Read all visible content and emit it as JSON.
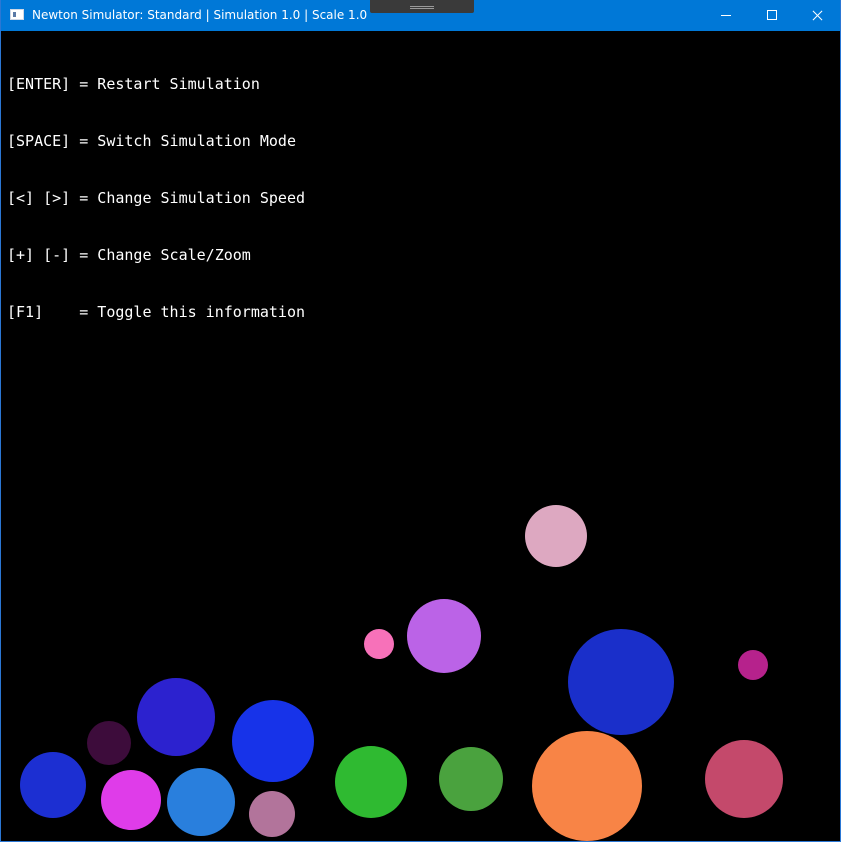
{
  "window": {
    "title": "Newton Simulator: Standard | Simulation 1.0 | Scale 1.0",
    "icon": "app-window-icon"
  },
  "controls": {
    "minimize": "minimize-icon",
    "maximize": "maximize-icon",
    "close": "close-icon"
  },
  "info": {
    "lines": [
      "[ENTER] = Restart Simulation",
      "[SPACE] = Switch Simulation Mode",
      "[<] [>] = Change Simulation Speed",
      "[+] [-] = Change Scale/Zoom",
      "[F1]    = Toggle this information"
    ]
  },
  "bodies": [
    {
      "name": "body-pink-light",
      "color": "#dda8c1"
    },
    {
      "name": "body-pink-small",
      "color": "#f771b9"
    },
    {
      "name": "body-violet",
      "color": "#bb63e7"
    },
    {
      "name": "body-blue-large",
      "color": "#1a2fca"
    },
    {
      "name": "body-magenta-small",
      "color": "#b6228c"
    },
    {
      "name": "body-indigo",
      "color": "#2c22cf"
    },
    {
      "name": "body-dark-purple",
      "color": "#3d0c3b"
    },
    {
      "name": "body-blue-bright",
      "color": "#1733e9"
    },
    {
      "name": "body-blue-left",
      "color": "#1c2fd2"
    },
    {
      "name": "body-magenta",
      "color": "#df3ce9"
    },
    {
      "name": "body-sky-blue",
      "color": "#297fdd"
    },
    {
      "name": "body-mauve",
      "color": "#b2749b"
    },
    {
      "name": "body-green-bright",
      "color": "#2fba31"
    },
    {
      "name": "body-green",
      "color": "#4aa23e"
    },
    {
      "name": "body-orange",
      "color": "#f88446"
    },
    {
      "name": "body-rose",
      "color": "#c4496b"
    }
  ]
}
